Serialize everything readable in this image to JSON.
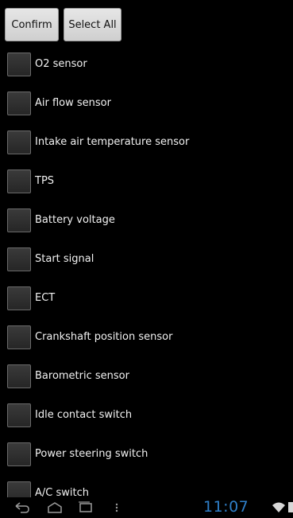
{
  "toolbar": {
    "confirm_label": "Confirm",
    "select_all_label": "Select All"
  },
  "sensors": [
    {
      "label": "O2 sensor",
      "checked": false
    },
    {
      "label": "Air flow sensor",
      "checked": false
    },
    {
      "label": "Intake air temperature sensor",
      "checked": false
    },
    {
      "label": "TPS",
      "checked": false
    },
    {
      "label": "Battery voltage",
      "checked": false
    },
    {
      "label": "Start signal",
      "checked": false
    },
    {
      "label": "ECT",
      "checked": false
    },
    {
      "label": "Crankshaft position sensor",
      "checked": false
    },
    {
      "label": "Barometric sensor",
      "checked": false
    },
    {
      "label": "Idle contact switch",
      "checked": false
    },
    {
      "label": "Power steering switch",
      "checked": false
    },
    {
      "label": "A/C switch",
      "checked": false
    }
  ],
  "system_bar": {
    "time": "11:07",
    "icons": [
      "back-icon",
      "home-icon",
      "recents-icon",
      "menu-icon",
      "wifi-icon",
      "battery-icon"
    ]
  },
  "colors": {
    "accent_clock": "#2f7fc9",
    "button_bg": "#dcdcdc",
    "top_accent": "#c62828"
  }
}
